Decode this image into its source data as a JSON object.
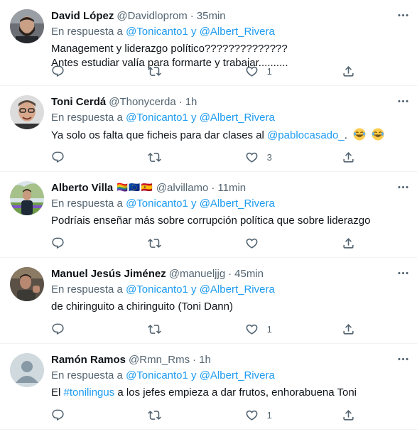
{
  "tweets": [
    {
      "name": "David López",
      "flags": "",
      "handle": "@Davidloprom",
      "dot": "·",
      "time": "35min",
      "reply_prefix": "En respuesta a",
      "reply_user1": "@Tonicanto1",
      "reply_and": "y",
      "reply_user2": "@Albert_Rivera",
      "text_line1": "Management y liderazgo político??????????????",
      "text_line2": "Antes estudiar valía para formarte y trabajar..........",
      "likes": "1",
      "avatar": "photo-beard"
    },
    {
      "name": "Toni Cerdá",
      "flags": "",
      "handle": "@Thonycerda",
      "dot": "·",
      "time": "1h",
      "reply_prefix": "En respuesta a",
      "reply_user1": "@Tonicanto1",
      "reply_and": "y",
      "reply_user2": "@Albert_Rivera",
      "text_before": "Ya solo os falta que ficheis para dar clases al",
      "text_mention": "@pablocasado_",
      "text_after": ".",
      "emoji": "laughing-tears-emoji",
      "likes": "3",
      "avatar": "photo-glasses"
    },
    {
      "name": "Alberto Villa",
      "flags": "🏳️‍🌈🇪🇺🇪🇸",
      "handle": "@alvillamo",
      "dot": "·",
      "time": "11min",
      "reply_prefix": "En respuesta a",
      "reply_user1": "@Tonicanto1",
      "reply_and": "y",
      "reply_user2": "@Albert_Rivera",
      "text_line1": "Podríais enseñar más sobre corrupción política que sobre liderazgo",
      "likes": "",
      "avatar": "photo-outdoor"
    },
    {
      "name": "Manuel Jesús Jiménez",
      "flags": "",
      "handle": "@manueljjg",
      "dot": "·",
      "time": "45min",
      "reply_prefix": "En respuesta a",
      "reply_user1": "@Tonicanto1",
      "reply_and": "y",
      "reply_user2": "@Albert_Rivera",
      "text_line1": "de chiringuito a chiringuito (Toni Dann)",
      "likes": "1",
      "avatar": "photo-dark"
    },
    {
      "name": "Ramón Ramos",
      "flags": "",
      "handle": "@Rmn_Rms",
      "dot": "·",
      "time": "1h",
      "reply_prefix": "En respuesta a",
      "reply_user1": "@Tonicanto1",
      "reply_and": "y",
      "reply_user2": "@Albert_Rivera",
      "text_before": "El",
      "text_hashtag": "#tonilingus",
      "text_after": "a los jefes empieza a dar frutos, enhorabuena Toni",
      "likes": "1",
      "avatar": "default-avatar"
    }
  ],
  "colors": {
    "accent": "#1d9bf0",
    "muted": "#536471",
    "text": "#0f1419",
    "divider": "#eff3f4"
  },
  "icons": [
    "reply-icon",
    "retweet-icon",
    "like-icon",
    "share-icon",
    "more-icon"
  ]
}
